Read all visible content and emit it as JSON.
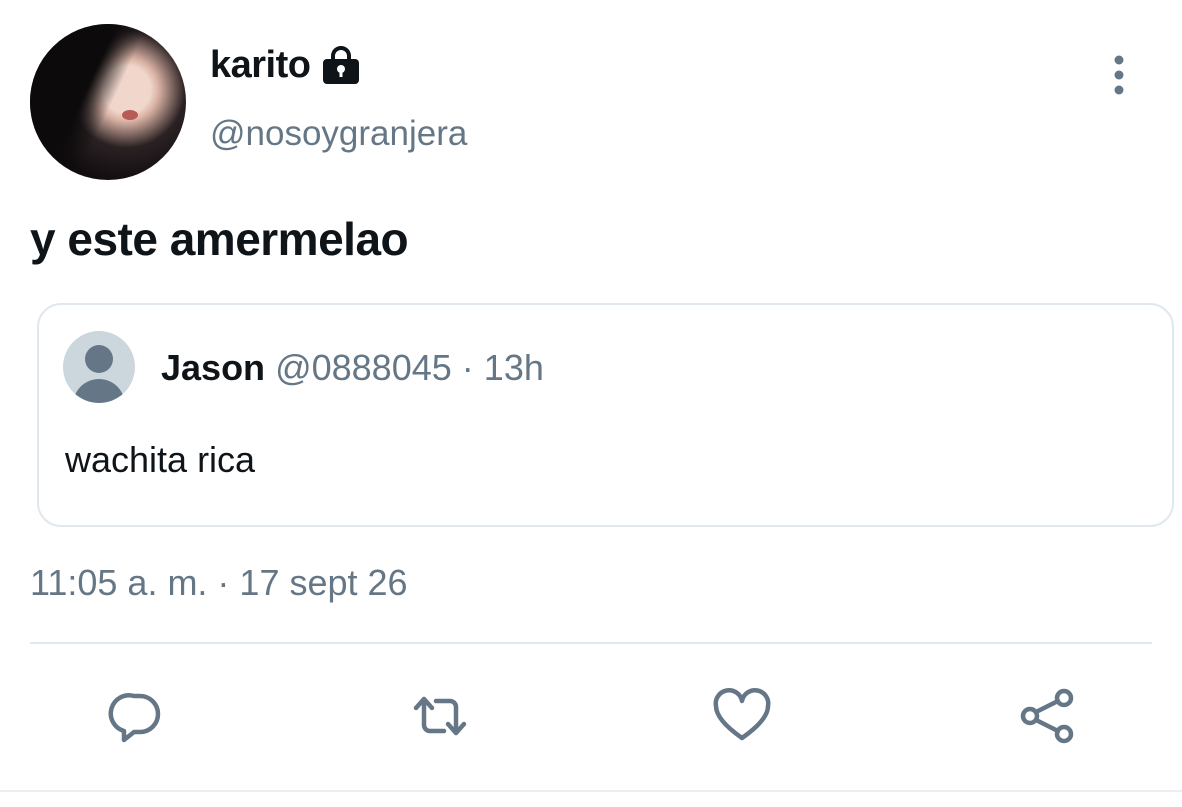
{
  "author": {
    "display_name": "karito",
    "handle": "@nosoygranjera",
    "protected_icon": "lock-icon"
  },
  "tweet": {
    "text": "y este amermelao",
    "timestamp": "11:05 a. m. · 17 sept 26"
  },
  "quoted_tweet": {
    "name": "Jason",
    "handle": "@0888045",
    "separator": "·",
    "time": "13h",
    "text": "wachita rica"
  },
  "actions": [
    {
      "name": "reply",
      "icon": "reply-icon"
    },
    {
      "name": "retweet",
      "icon": "retweet-icon"
    },
    {
      "name": "like",
      "icon": "heart-icon"
    },
    {
      "name": "share",
      "icon": "share-icon"
    }
  ],
  "colors": {
    "text": "#0f1419",
    "secondary": "#657786",
    "border": "#e1e8ed"
  }
}
